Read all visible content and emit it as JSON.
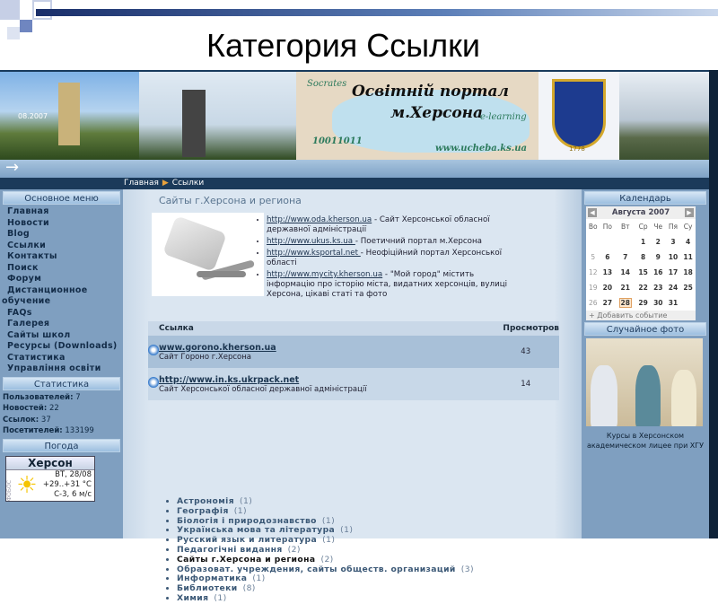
{
  "slide": {
    "title": "Категория Ссылки"
  },
  "banner": {
    "portal_line1": "Освітній портал",
    "portal_line2": "м.Херсона",
    "socrates": "Socrates",
    "elearning": "e-learning",
    "binary": "10011011",
    "url": "www.ucheba.ks.ua",
    "date_stamp": "08.2007",
    "emblem_year": "1778"
  },
  "nav": {
    "arrow": "→"
  },
  "breadcrumb": {
    "home": "Главная",
    "current": "Ссылки"
  },
  "left": {
    "menu_title": "Основное меню",
    "menu": [
      "Главная",
      "Новости",
      "Blog",
      "Ссылки",
      "Контакты",
      "Поиск",
      "Форум",
      "Дистанционное",
      "обучение",
      "FAQs",
      "Галерея",
      "Сайты школ",
      "Ресурсы (Downloads)",
      "Статистика",
      "Управління освіти"
    ],
    "stats_title": "Статистика",
    "stats": [
      {
        "label": "Пользователей:",
        "value": "7"
      },
      {
        "label": "Новостей:",
        "value": "22"
      },
      {
        "label": "Ссылок:",
        "value": "37"
      },
      {
        "label": "Посетителей:",
        "value": "133199"
      }
    ],
    "weather_title": "Погода",
    "weather": {
      "city": "Херсон",
      "day": "ВТ, 28/08",
      "temp": "+29..+31 °C",
      "wind": "С-3, 6 м/с",
      "brand": "ФОБОС"
    }
  },
  "main": {
    "section_title": "Сайты г.Херсона и региона",
    "bullets": [
      {
        "url": "http://www.oda.kherson.ua",
        "desc": " - Сайт Херсонської обласної державної адміністрації"
      },
      {
        "url": "http://www.ukus.ks.ua ",
        "desc": " - Поетичний портал м.Херсона"
      },
      {
        "url": "http://www.ksportal.net ",
        "desc": " - Неофіційний портал Херсонської області"
      },
      {
        "url": "http://www.mycity.kherson.ua",
        "desc": " - \"Мой город\" містить інформацію про історію міста, видатних херсонців, вулиці Херсона, цікаві статі та фото"
      }
    ],
    "table": {
      "col_link": "Ссылка",
      "col_views": "Просмотров",
      "rows": [
        {
          "url": "www.gorono.kherson.ua",
          "desc": "Сайт Гороно г.Херсона",
          "views": "43"
        },
        {
          "url": "http://www.in.ks.ukrpack.net",
          "desc": "Сайт Херсонської обласної державної адміністрації",
          "views": "14"
        }
      ]
    },
    "categories": [
      {
        "name": "Астрономія",
        "count": "(1)"
      },
      {
        "name": "Географія",
        "count": "(1)"
      },
      {
        "name": "Біологія і природознавство",
        "count": "(1)"
      },
      {
        "name": "Українська мова та література",
        "count": "(1)"
      },
      {
        "name": "Русский язык и литература",
        "count": "(1)"
      },
      {
        "name": "Педагогічні видання",
        "count": "(2)"
      },
      {
        "name": "Сайты г.Херсона и региона",
        "count": "(2)"
      },
      {
        "name": "Образоват. учреждения, сайты обществ. организаций",
        "count": "(3)"
      },
      {
        "name": "Информатика",
        "count": "(1)"
      },
      {
        "name": "Библиотеки",
        "count": "(8)"
      },
      {
        "name": "Химия",
        "count": "(1)"
      }
    ]
  },
  "right": {
    "calendar_title": "Календарь",
    "month": "Августа 2007",
    "weekdays": [
      "Во",
      "По",
      "Вт",
      "Ср",
      "Че",
      "Пя",
      "Су"
    ],
    "weeks": [
      [
        "",
        "",
        "",
        "1",
        "2",
        "3",
        "4"
      ],
      [
        "5",
        "6",
        "7",
        "8",
        "9",
        "10",
        "11"
      ],
      [
        "12",
        "13",
        "14",
        "15",
        "16",
        "17",
        "18"
      ],
      [
        "19",
        "20",
        "21",
        "22",
        "23",
        "24",
        "25"
      ],
      [
        "26",
        "27",
        "28",
        "29",
        "30",
        "31",
        ""
      ]
    ],
    "today": "28",
    "add_event": "+ Добавить событие",
    "photo_title": "Случайное фото",
    "photo_caption": "Курсы в Херсонском академическом лицее при ХГУ"
  }
}
